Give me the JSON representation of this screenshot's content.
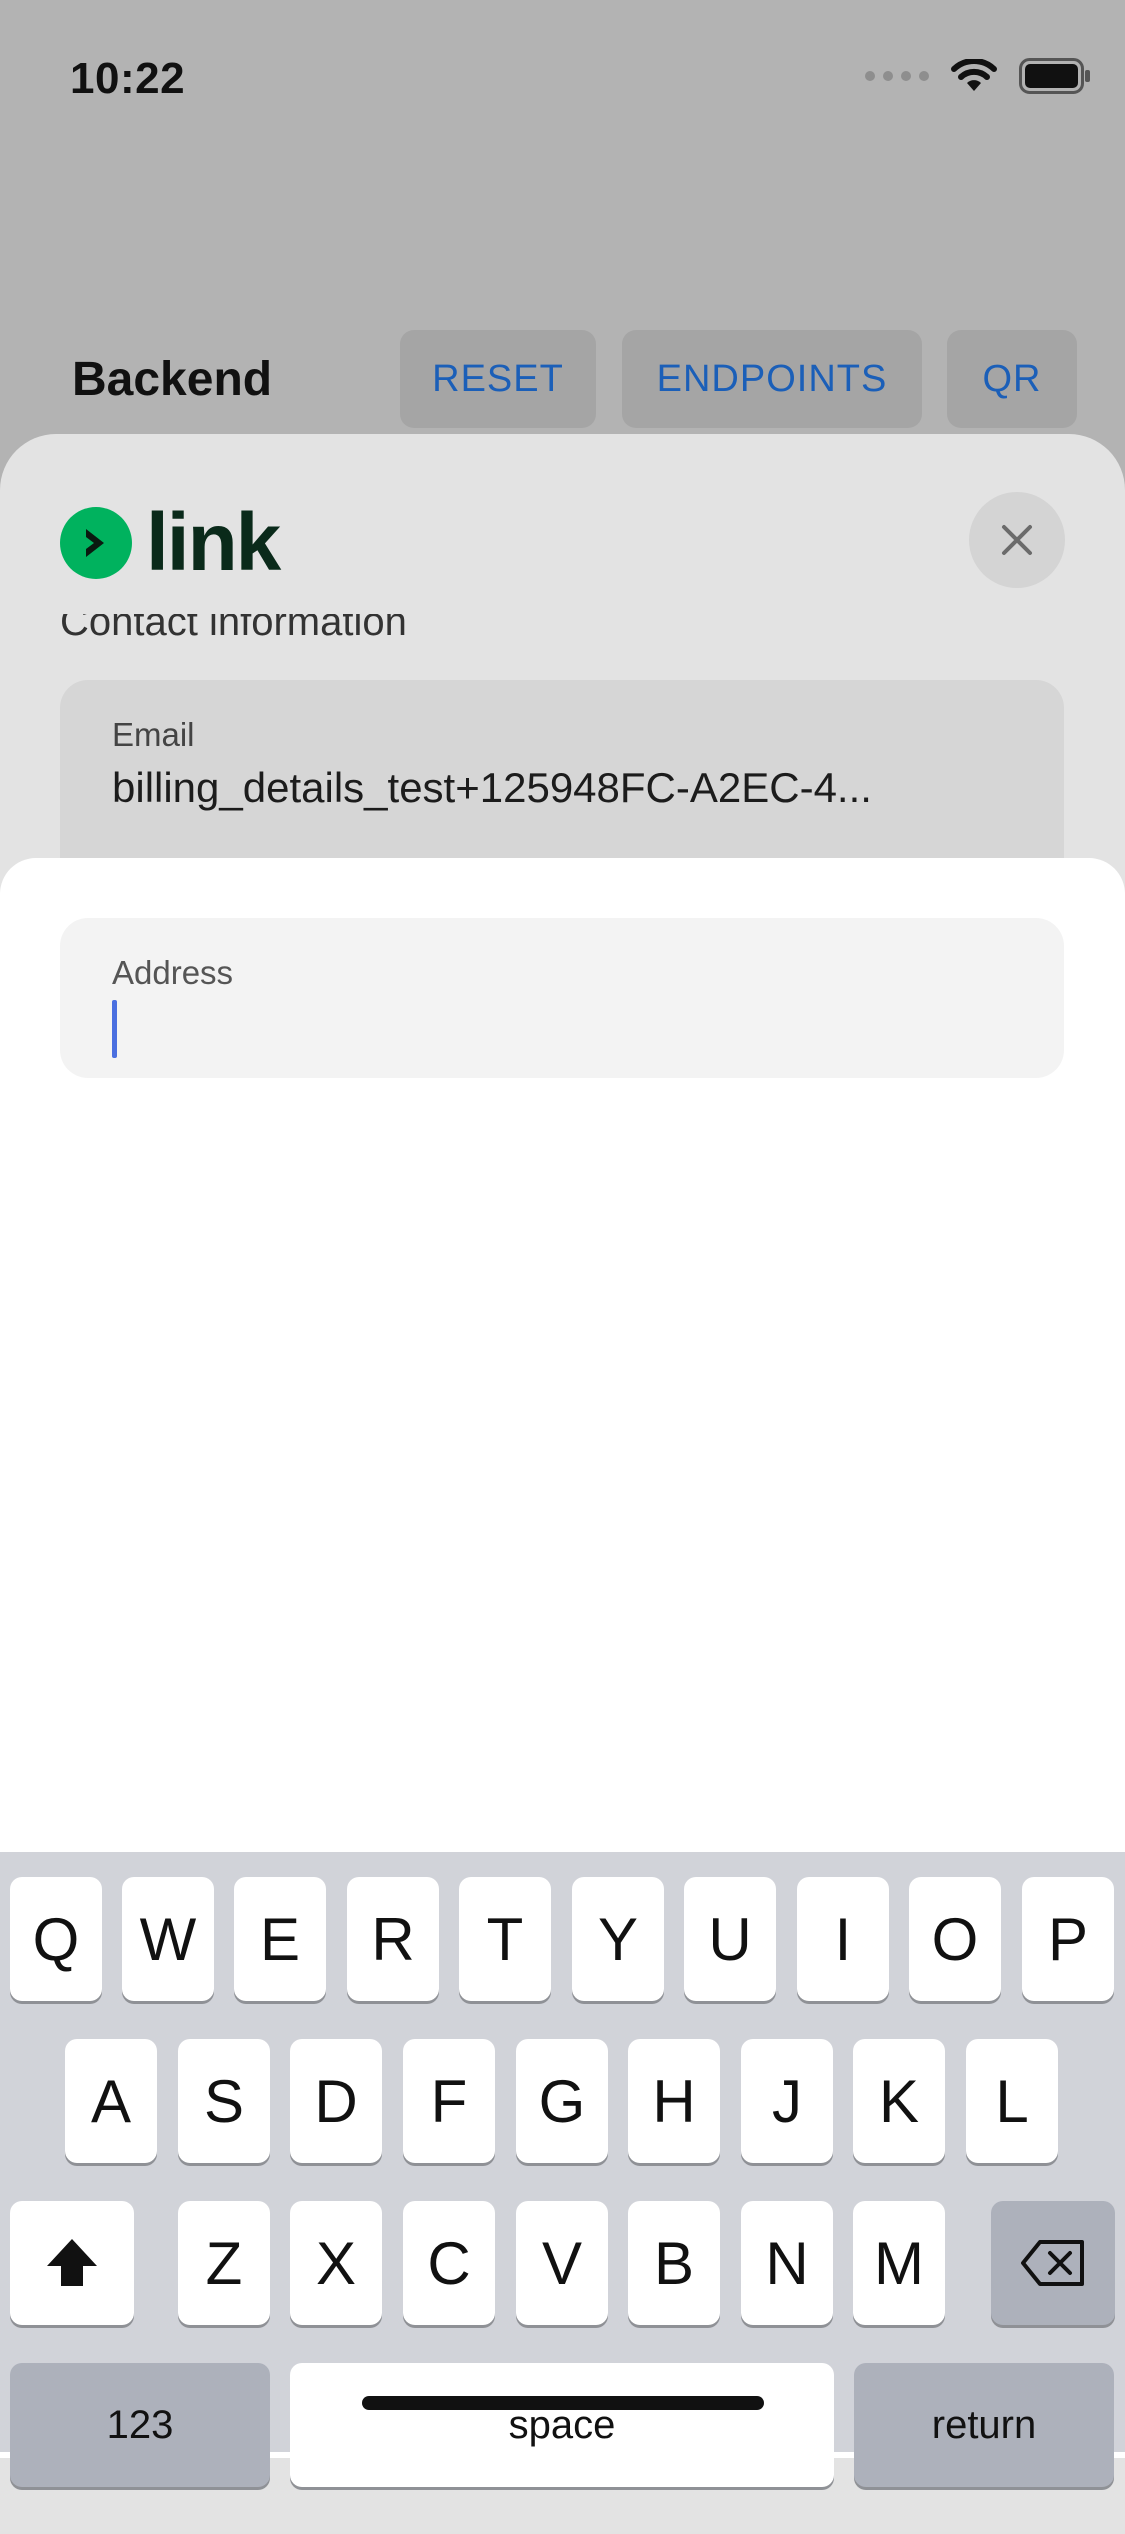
{
  "status_bar": {
    "time": "10:22"
  },
  "header": {
    "title": "Backend",
    "buttons": {
      "reset": "RESET",
      "endpoints": "ENDPOINTS",
      "qr": "QR"
    }
  },
  "link_sheet": {
    "logo_text": "link",
    "section_label": "Contact information",
    "email": {
      "label": "Email",
      "value": "billing_details_test+125948FC-A2EC-4..."
    }
  },
  "address_sheet": {
    "address": {
      "label": "Address",
      "value": ""
    }
  },
  "keyboard": {
    "row1": [
      "Q",
      "W",
      "E",
      "R",
      "T",
      "Y",
      "U",
      "I",
      "O",
      "P"
    ],
    "row2": [
      "A",
      "S",
      "D",
      "F",
      "G",
      "H",
      "J",
      "K",
      "L"
    ],
    "row3": [
      "Z",
      "X",
      "C",
      "V",
      "B",
      "N",
      "M"
    ],
    "bottom": {
      "numbers": "123",
      "space": "space",
      "return": "return"
    }
  },
  "colors": {
    "link_green": "#00b25e",
    "button_blue": "#1b5fb8",
    "caret": "#4a6fe0"
  }
}
